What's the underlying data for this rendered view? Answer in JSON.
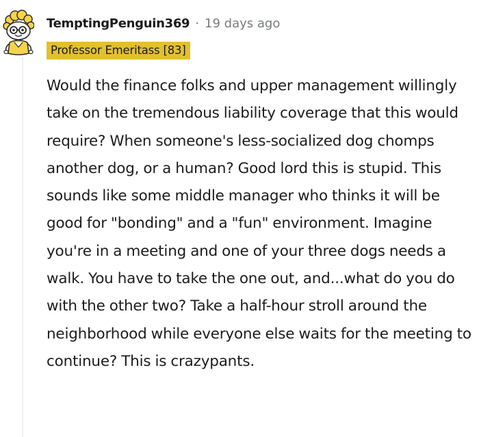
{
  "comment": {
    "username": "TemptingPenguin369",
    "separator": "·",
    "timestamp": "19 days ago",
    "flair": "Professor Emeritass [83]",
    "body": "Would the finance folks and upper management willingly take on the tremendous liability coverage that this would require? When someone's less-socialized dog chomps another dog, or a human? Good lord this is stupid. This sounds like some middle manager who thinks it will be good for \"bonding\" and a \"fun\" environment. Imagine you're in a meeting and one of your three dogs needs a walk. You have to take the one out, and...what do you do with the other two? Take a half-hour stroll around the neighborhood while everyone else waits for the meeting to continue? This is crazypants."
  },
  "colors": {
    "flair_background": "#e1c02e",
    "meta_text": "#787c7e",
    "body_text": "#1c1c1c",
    "thread_line": "#edeff1"
  },
  "icons": {
    "avatar": "snoo-avatar-icon"
  }
}
